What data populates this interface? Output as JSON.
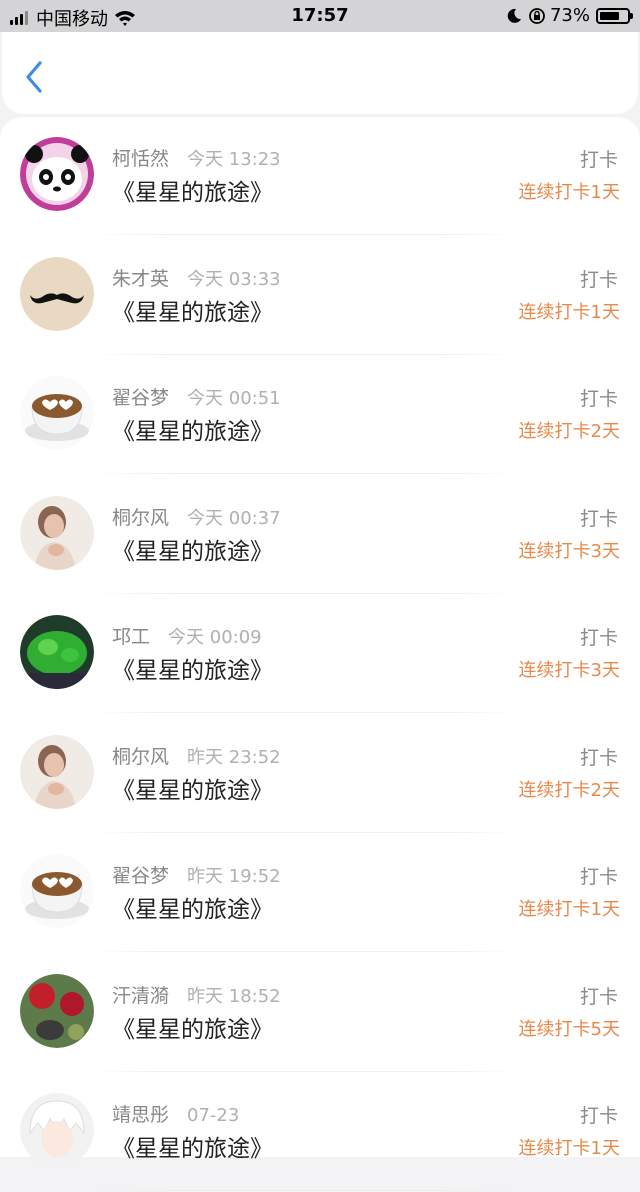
{
  "status_bar": {
    "carrier": "中国移动",
    "time": "17:57",
    "battery": "73%",
    "battery_level": 0.73,
    "icons": [
      "signal-icon",
      "wifi-icon",
      "moon-icon",
      "orientation-lock-icon",
      "battery-icon"
    ]
  },
  "nav": {
    "back_icon": "chevron-left-icon",
    "accent_color": "#3a8ee6"
  },
  "colors": {
    "streak": "#e8894a",
    "name": "#888888",
    "title": "#222222"
  },
  "entries": [
    {
      "name": "柯恬然",
      "time": "今天 13:23",
      "title": "《星星的旅途》",
      "action": "打卡",
      "streak": "连续打卡1天",
      "avatar": "panda-avatar"
    },
    {
      "name": "朱才英",
      "time": "今天 03:33",
      "title": "《星星的旅途》",
      "action": "打卡",
      "streak": "连续打卡1天",
      "avatar": "mustache-avatar"
    },
    {
      "name": "翟谷梦",
      "time": "今天 00:51",
      "title": "《星星的旅途》",
      "action": "打卡",
      "streak": "连续打卡2天",
      "avatar": "coffee-avatar"
    },
    {
      "name": "桐尔风",
      "time": "今天 00:37",
      "title": "《星星的旅途》",
      "action": "打卡",
      "streak": "连续打卡3天",
      "avatar": "woman-avatar"
    },
    {
      "name": "邛工",
      "time": "今天 00:09",
      "title": "《星星的旅途》",
      "action": "打卡",
      "streak": "连续打卡3天",
      "avatar": "jelly-avatar"
    },
    {
      "name": "桐尔风",
      "time": "昨天 23:52",
      "title": "《星星的旅途》",
      "action": "打卡",
      "streak": "连续打卡2天",
      "avatar": "woman-avatar"
    },
    {
      "name": "翟谷梦",
      "time": "昨天 19:52",
      "title": "《星星的旅途》",
      "action": "打卡",
      "streak": "连续打卡1天",
      "avatar": "coffee-avatar"
    },
    {
      "name": "汗清漪",
      "time": "昨天 18:52",
      "title": "《星星的旅途》",
      "action": "打卡",
      "streak": "连续打卡5天",
      "avatar": "flower-avatar"
    },
    {
      "name": "靖思彤",
      "time": "07-23",
      "title": "《星星的旅途》",
      "action": "打卡",
      "streak": "连续打卡1天",
      "avatar": "anime-avatar"
    }
  ]
}
